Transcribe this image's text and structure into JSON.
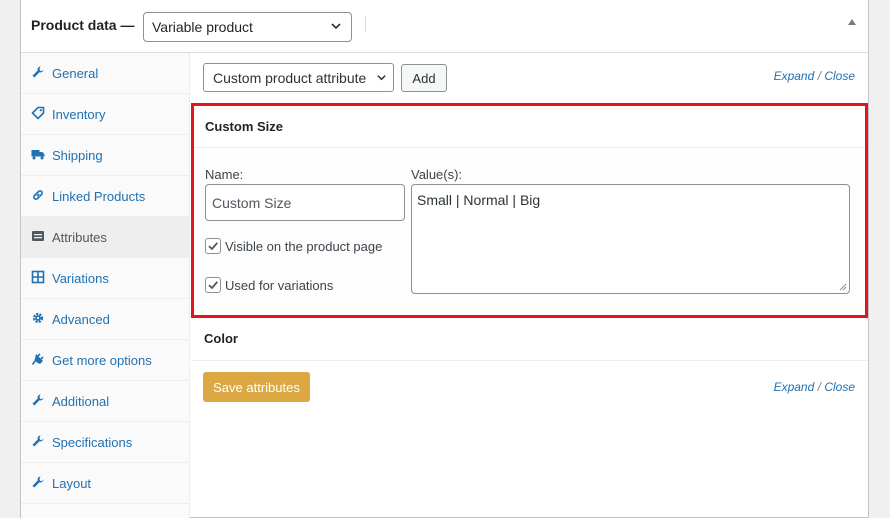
{
  "header": {
    "label": "Product data —",
    "product_type": "Variable product"
  },
  "tabs": [
    {
      "label": "General",
      "icon": "wrench-icon"
    },
    {
      "label": "Inventory",
      "icon": "tag-icon"
    },
    {
      "label": "Shipping",
      "icon": "truck-icon"
    },
    {
      "label": "Linked Products",
      "icon": "link-icon"
    },
    {
      "label": "Attributes",
      "icon": "list-icon"
    },
    {
      "label": "Variations",
      "icon": "grid-icon"
    },
    {
      "label": "Advanced",
      "icon": "gear-icon"
    },
    {
      "label": "Get more options",
      "icon": "plugin-icon"
    },
    {
      "label": "Additional",
      "icon": "wrench-icon"
    },
    {
      "label": "Specifications",
      "icon": "wrench-icon"
    },
    {
      "label": "Layout",
      "icon": "wrench-icon"
    }
  ],
  "active_tab": "Attributes",
  "toolbar": {
    "attribute_select": "Custom product attribute",
    "add_label": "Add",
    "expand": "Expand",
    "separator": "/",
    "close": "Close"
  },
  "attribute": {
    "title": "Custom Size",
    "name_label": "Name:",
    "name_value": "Custom Size",
    "values_label": "Value(s):",
    "values_value": "Small | Normal | Big",
    "visible_label": "Visible on the product page",
    "visible_checked": true,
    "variations_label": "Used for variations",
    "variations_checked": true
  },
  "color_attribute": {
    "title": "Color"
  },
  "save_label": "Save attributes",
  "colors": {
    "link": "#2271b1",
    "highlight": "#e3141c",
    "save_button": "#dba843"
  }
}
